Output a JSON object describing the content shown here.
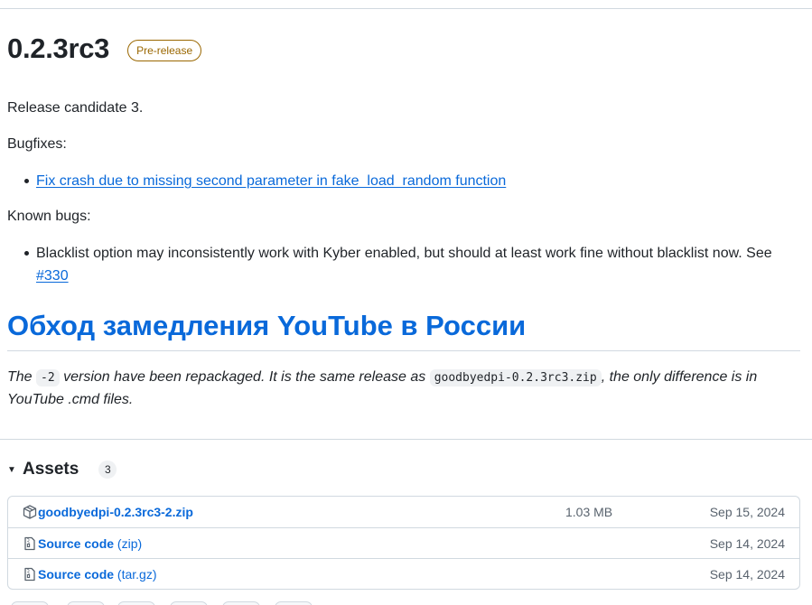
{
  "release": {
    "title": "0.2.3rc3",
    "badge": "Pre-release"
  },
  "body": {
    "intro": "Release candidate 3.",
    "bugfixes_heading": "Bugfixes:",
    "bugfixes": [
      "Fix crash due to missing second parameter in fake_load_random function"
    ],
    "known_heading": "Known bugs:",
    "known_text": "Blacklist option may inconsistently work with Kyber enabled, but should at least work fine without blacklist now. See ",
    "known_link": "#330",
    "ru_heading": "Обход замедления YouTube в России",
    "note_part1": "The ",
    "note_code1": "-2",
    "note_part2": " version have been repackaged. It is the same release as ",
    "note_code2": "goodbyedpi-0.2.3rc3.zip",
    "note_part3": ", the only difference is in YouTube .cmd files."
  },
  "assets": {
    "title": "Assets",
    "count": "3",
    "items": [
      {
        "name": "goodbyedpi-0.2.3rc3-2.zip",
        "suffix": "",
        "size": "1.03 MB",
        "date": "Sep 15, 2024",
        "icon": "package-icon"
      },
      {
        "name": "Source code",
        "suffix": " (zip)",
        "size": "",
        "date": "Sep 14, 2024",
        "icon": "file-zip-icon"
      },
      {
        "name": "Source code",
        "suffix": " (tar.gz)",
        "size": "",
        "date": "Sep 14, 2024",
        "icon": "file-zip-icon"
      }
    ]
  },
  "colors": {
    "link": "#0969da",
    "prerelease": "#9a6700",
    "border": "#d1d9e0",
    "muted": "#59636e"
  }
}
